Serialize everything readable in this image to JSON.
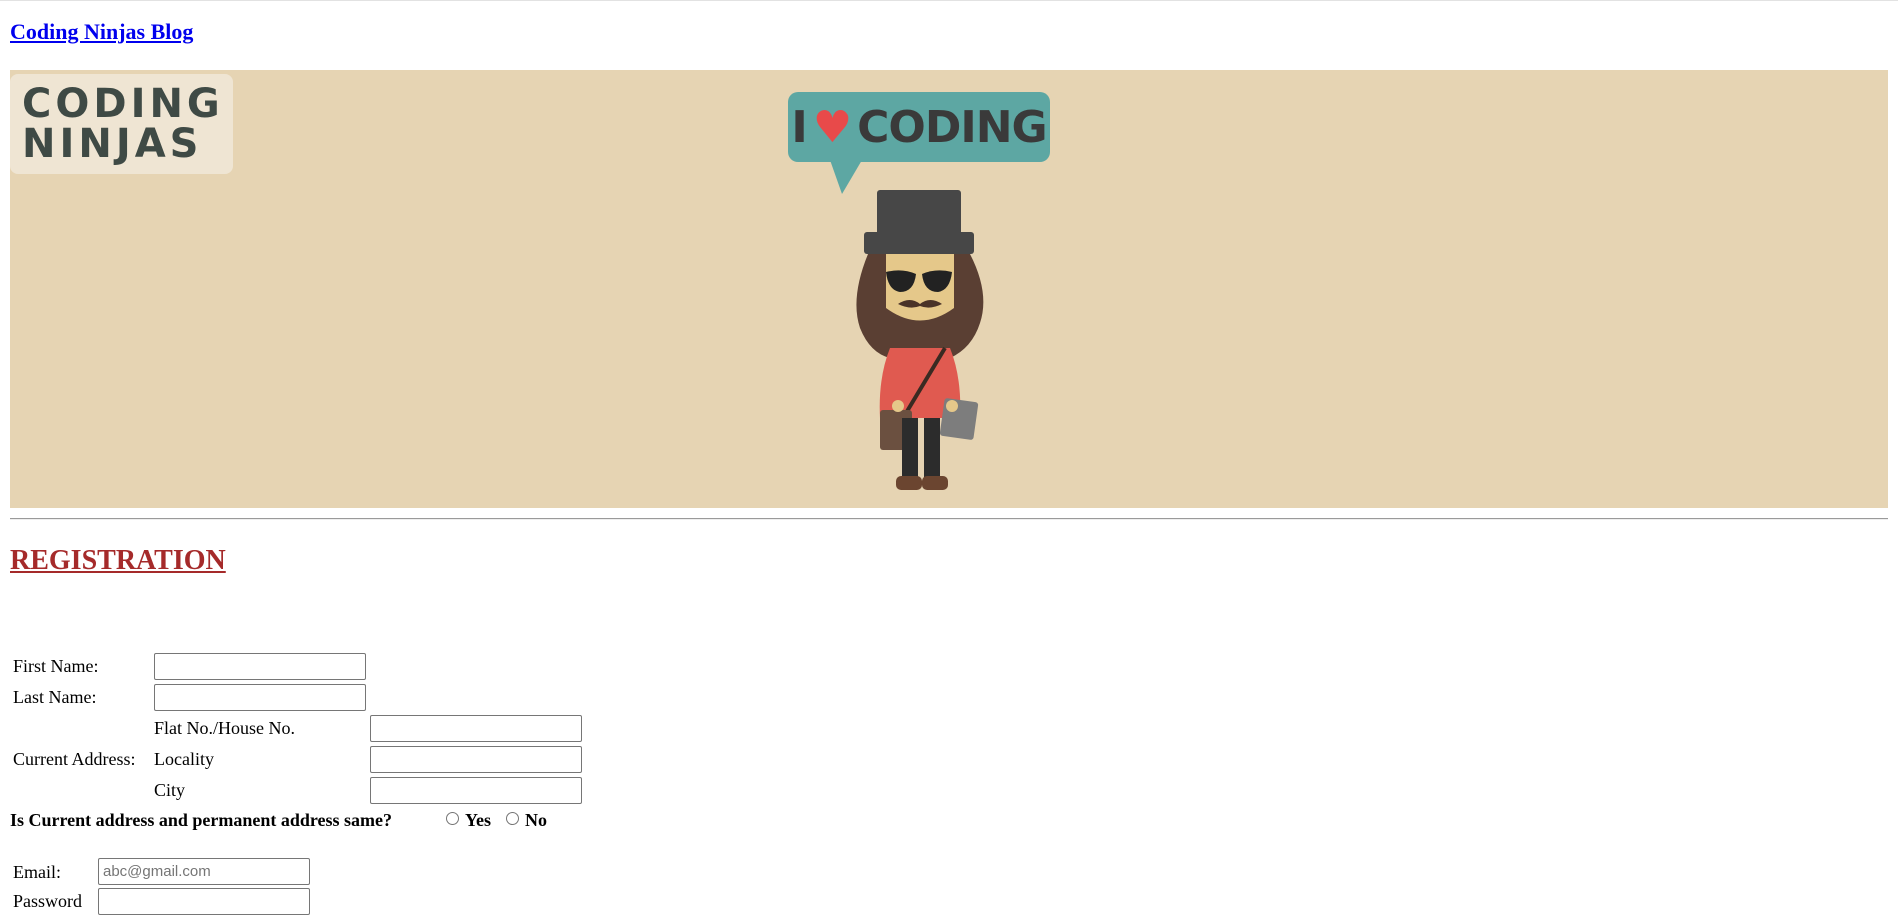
{
  "blog_link": "Coding Ninjas Blog",
  "banner": {
    "logo_line1": "CODING",
    "logo_line2": "NINJAS",
    "bubble_text_left": "I",
    "bubble_text_right": "CODING"
  },
  "registration": {
    "title": "REGISTRATION",
    "first_name_label": "First Name:",
    "last_name_label": "Last Name:",
    "current_address_label": "Current Address:",
    "flat_label": "Flat No./House No.",
    "locality_label": "Locality",
    "city_label": "City",
    "same_address_question": "Is Current address and permanent address same?",
    "yes_label": "Yes",
    "no_label": "No",
    "email_label": "Email:",
    "email_placeholder": "abc@gmail.com",
    "password_label": "Password"
  },
  "colors": {
    "link": "#0000ee",
    "title": "#a52a2a",
    "banner_bg": "#e6d4b3",
    "bubble": "#5da7a3"
  }
}
